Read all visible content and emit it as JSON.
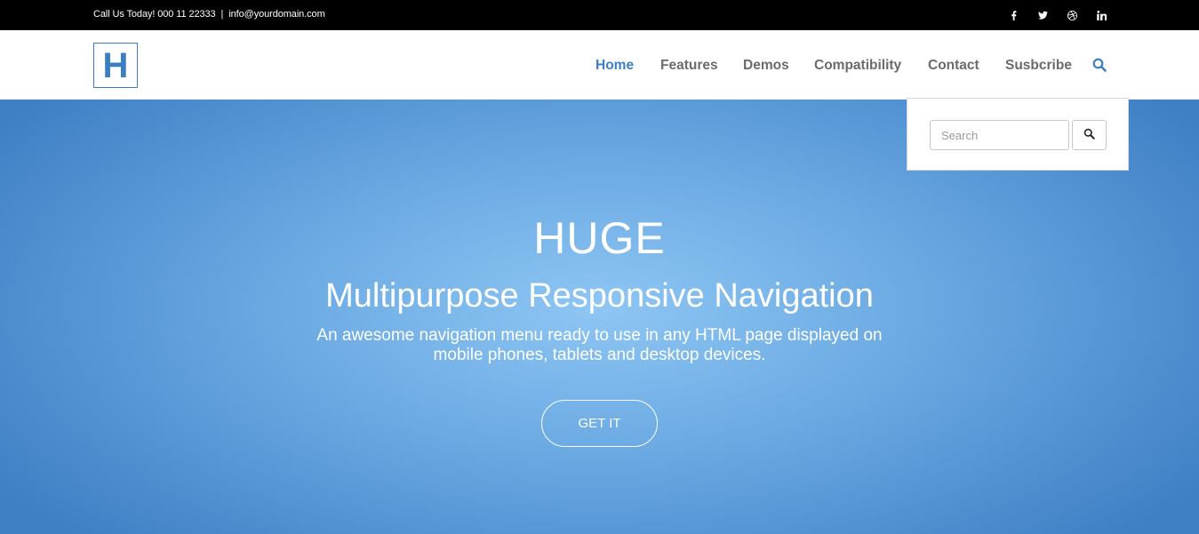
{
  "topbar": {
    "phone_text": "Call Us Today! 000 11 22333",
    "separator": "|",
    "email": "info@yourdomain.com",
    "social": [
      "facebook-icon",
      "twitter-icon",
      "dribbble-icon",
      "linkedin-icon"
    ]
  },
  "header": {
    "logo_letter": "H",
    "nav": [
      {
        "label": "Home",
        "active": true
      },
      {
        "label": "Features",
        "active": false
      },
      {
        "label": "Demos",
        "active": false
      },
      {
        "label": "Compatibility",
        "active": false
      },
      {
        "label": "Contact",
        "active": false
      },
      {
        "label": "Susbcribe",
        "active": false
      }
    ]
  },
  "search": {
    "placeholder": "Search",
    "value": ""
  },
  "hero": {
    "title": "HUGE",
    "subtitle": "Multipurpose Responsive Navigation",
    "description": "An awesome navigation menu ready to use in any HTML page displayed on mobile phones, tablets and desktop devices.",
    "button_label": "GET IT"
  },
  "colors": {
    "accent": "#3c7ec2",
    "topbar_bg": "#000000",
    "nav_text": "#6b6b6b",
    "hero_light": "#8ec6f4",
    "hero_dark": "#3f80c5"
  }
}
